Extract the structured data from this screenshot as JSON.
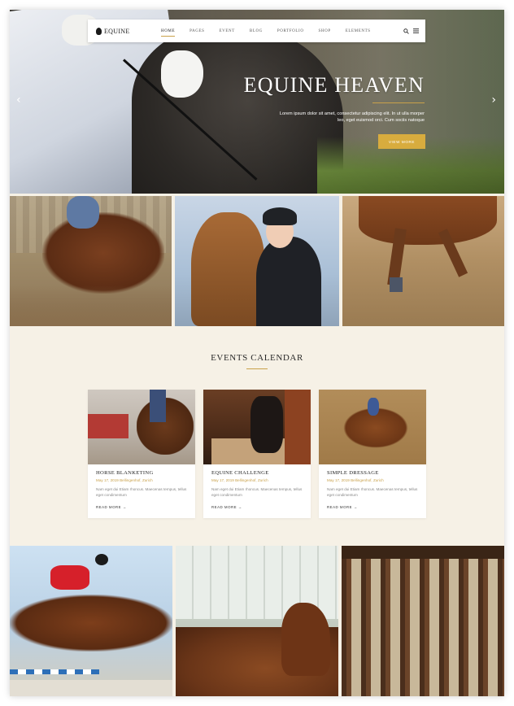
{
  "nav": {
    "logo": "EQUINE",
    "items": [
      {
        "label": "HOME",
        "active": true
      },
      {
        "label": "PAGES",
        "active": false
      },
      {
        "label": "EVENT",
        "active": false
      },
      {
        "label": "BLOG",
        "active": false
      },
      {
        "label": "PORTFOLIO",
        "active": false
      },
      {
        "label": "SHOP",
        "active": false
      },
      {
        "label": "ELEMENTS",
        "active": false
      }
    ],
    "icons": [
      "search-icon",
      "menu-icon"
    ]
  },
  "hero": {
    "title": "EQUINE HEAVEN",
    "subtitle": "Lorem ipsum dolor sit amet, consectetur adipiscing elit. In ut ulla morper leo, eget euismod orci. Cum sociis natoque",
    "button": "VIEW MORE",
    "prev_icon": "chevron-left-icon",
    "next_icon": "chevron-right-icon"
  },
  "events": {
    "title": "EVENTS CALENDAR",
    "cards": [
      {
        "title": "HORSE BLANKETING",
        "meta": "May 17, 2019 Bellingenhof, Zurich",
        "text": "Nam eget dui Etiam rhoncus. Maecenas tempus, tellus eget condimentum",
        "link": "READ MORE"
      },
      {
        "title": "EQUINE CHALLENGE",
        "meta": "May 17, 2019 Bellingenhof, Zurich",
        "text": "Nam eget dui Etiam rhoncus. Maecenas tempus, tellus eget condimentum",
        "link": "READ MORE"
      },
      {
        "title": "SIMPLE DRESSAGE",
        "meta": "May 17, 2019 Bellingenhof, Zurich",
        "text": "Nam eget dui Etiam rhoncus. Maecenas tempus, tellus eget condimentum",
        "link": "READ MORE"
      }
    ]
  },
  "colors": {
    "accent": "#d8ac3e",
    "background": "#f6f1e6",
    "text": "#222222"
  }
}
